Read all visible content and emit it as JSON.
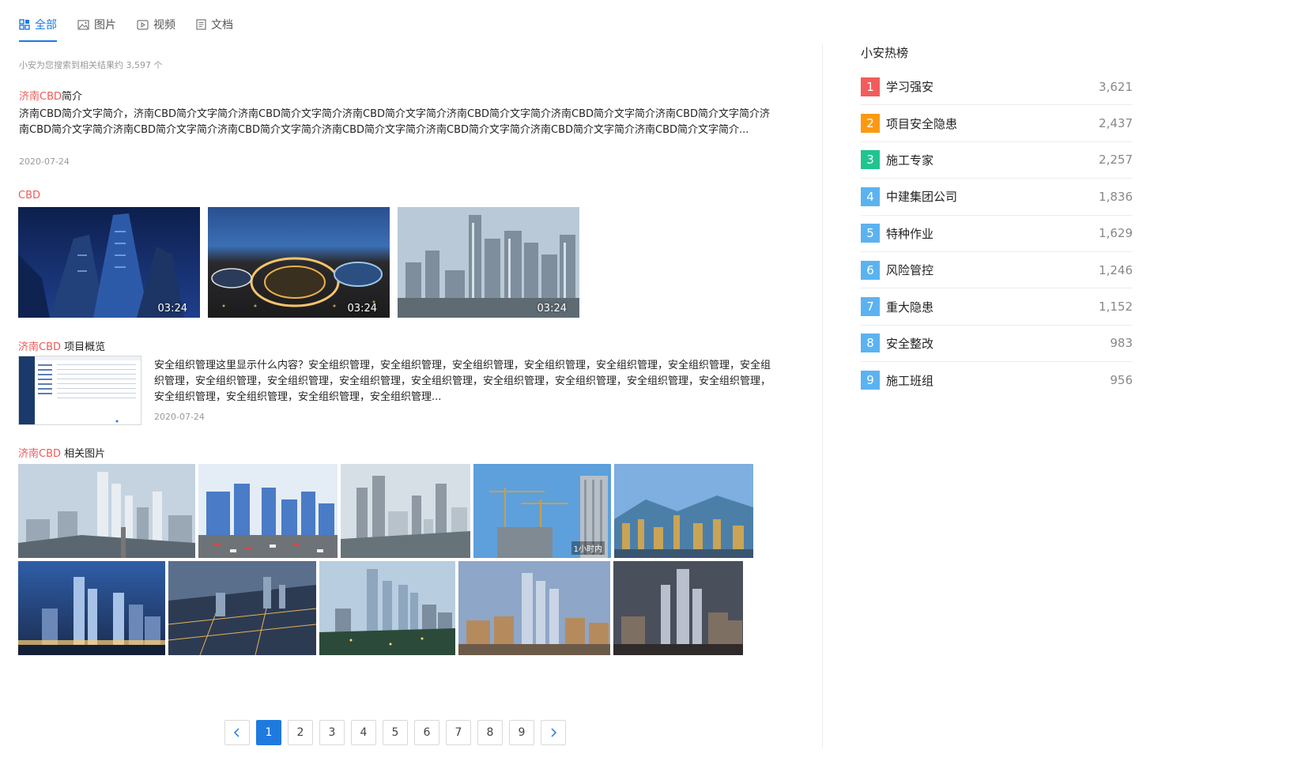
{
  "tabs": [
    {
      "label": "全部",
      "icon": "grid-icon",
      "active": true
    },
    {
      "label": "图片",
      "icon": "image-icon",
      "active": false
    },
    {
      "label": "视频",
      "icon": "video-icon",
      "active": false
    },
    {
      "label": "文档",
      "icon": "document-icon",
      "active": false
    }
  ],
  "result_count": "小安为您搜索到相关结果约 3,597 个",
  "results": {
    "intro": {
      "title_highlight": "济南CBD",
      "title_rest": "简介",
      "description": "济南CBD简介文字简介，济南CBD简介文字简介济南CBD简介文字简介济南CBD简介文字简介济南CBD简介文字简介济南CBD简介文字简介济南CBD简介文字简介济南CBD简介文字简介济南CBD简介文字简介济南CBD简介文字简介济南CBD简介文字简介济南CBD简介文字简介济南CBD简介文字简介济南CBD简介文字简介...",
      "date": "2020-07-24"
    },
    "videos": {
      "title": "CBD",
      "items": [
        {
          "duration": "03:24"
        },
        {
          "duration": "03:24"
        },
        {
          "duration": "03:24"
        }
      ]
    },
    "overview": {
      "title_highlight": "济南CBD",
      "title_rest": " 项目概览",
      "description": "安全组织管理这里显示什么内容？安全组织管理，安全组织管理，安全组织管理，安全组织管理，安全组织管理，安全组织管理，安全组织管理，安全组织管理，安全组织管理，安全组织管理，安全组织管理，安全组织管理，安全组织管理，安全组织管理，安全组织管理，安全组织管理，安全组织管理，安全组织管理，安全组织管理...",
      "date": "2020-07-24"
    },
    "images": {
      "title_highlight": "济南CBD",
      "title_rest": " 相关图片",
      "badge": "1小时内"
    }
  },
  "pagination": {
    "pages": [
      "1",
      "2",
      "3",
      "4",
      "5",
      "6",
      "7",
      "8",
      "9"
    ],
    "current": "1"
  },
  "hot": {
    "title": "小安热榜",
    "items": [
      {
        "rank": "1",
        "label": "学习强安",
        "count": "3,621",
        "color": "#f25c5c"
      },
      {
        "rank": "2",
        "label": "项目安全隐患",
        "count": "2,437",
        "color": "#fa9a13"
      },
      {
        "rank": "3",
        "label": "施工专家",
        "count": "2,257",
        "color": "#1fc48f"
      },
      {
        "rank": "4",
        "label": "中建集团公司",
        "count": "1,836",
        "color": "#5ab3f0"
      },
      {
        "rank": "5",
        "label": "特种作业",
        "count": "1,629",
        "color": "#5ab3f0"
      },
      {
        "rank": "6",
        "label": "风险管控",
        "count": "1,246",
        "color": "#5ab3f0"
      },
      {
        "rank": "7",
        "label": "重大隐患",
        "count": "1,152",
        "color": "#5ab3f0"
      },
      {
        "rank": "8",
        "label": "安全整改",
        "count": "983",
        "color": "#5ab3f0"
      },
      {
        "rank": "9",
        "label": "施工班组",
        "count": "956",
        "color": "#5ab3f0"
      }
    ]
  },
  "colors": {
    "accent": "#1f7ae0",
    "highlight": "#ef5a5a"
  }
}
